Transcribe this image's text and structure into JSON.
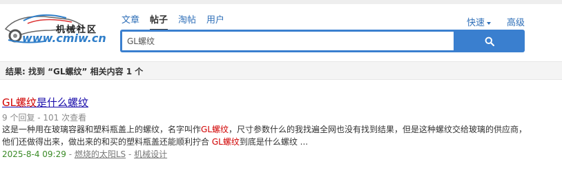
{
  "site": {
    "logo_text": "机械社区",
    "logo_url_text": "www.cmiw.cn"
  },
  "tabs": [
    {
      "label": "文章",
      "active": false
    },
    {
      "label": "帖子",
      "active": true
    },
    {
      "label": "淘帖",
      "active": false
    },
    {
      "label": "用户",
      "active": false
    }
  ],
  "header_links": {
    "quick": "快速",
    "advanced": "高级"
  },
  "search": {
    "value": "GL螺纹",
    "button_icon": "search-icon"
  },
  "results_summary": "结果: 找到 “GL螺纹” 相关内容 1 个",
  "result": {
    "title_highlight": "GL螺纹",
    "title_rest": "是什么螺纹",
    "meta": "9 个回复 - 101 次查看",
    "snippet": {
      "line1_a": "这是一种用在玻璃容器和塑料瓶盖上的螺纹，名字叫作",
      "line1_hl": "GL螺纹",
      "line1_b": "，尺寸参数什么的我找遍全网也没有找到结果，但是这种螺纹交给玻璃的供应商，",
      "line2_a": "他们还做得出来，做出来的和买的塑料瓶盖还能顺利拧合 ",
      "line2_hl": "GL螺纹",
      "line2_b": "到底是什么螺纹 ..."
    },
    "date": "2025-8-4 09:29",
    "sep1": " - ",
    "author": "燃烧的太阳LS",
    "sep2": " - ",
    "forum": "机械设计"
  },
  "colors": {
    "accent": "#3a7fcf",
    "highlight": "#d00000",
    "date": "#3a8a26"
  }
}
